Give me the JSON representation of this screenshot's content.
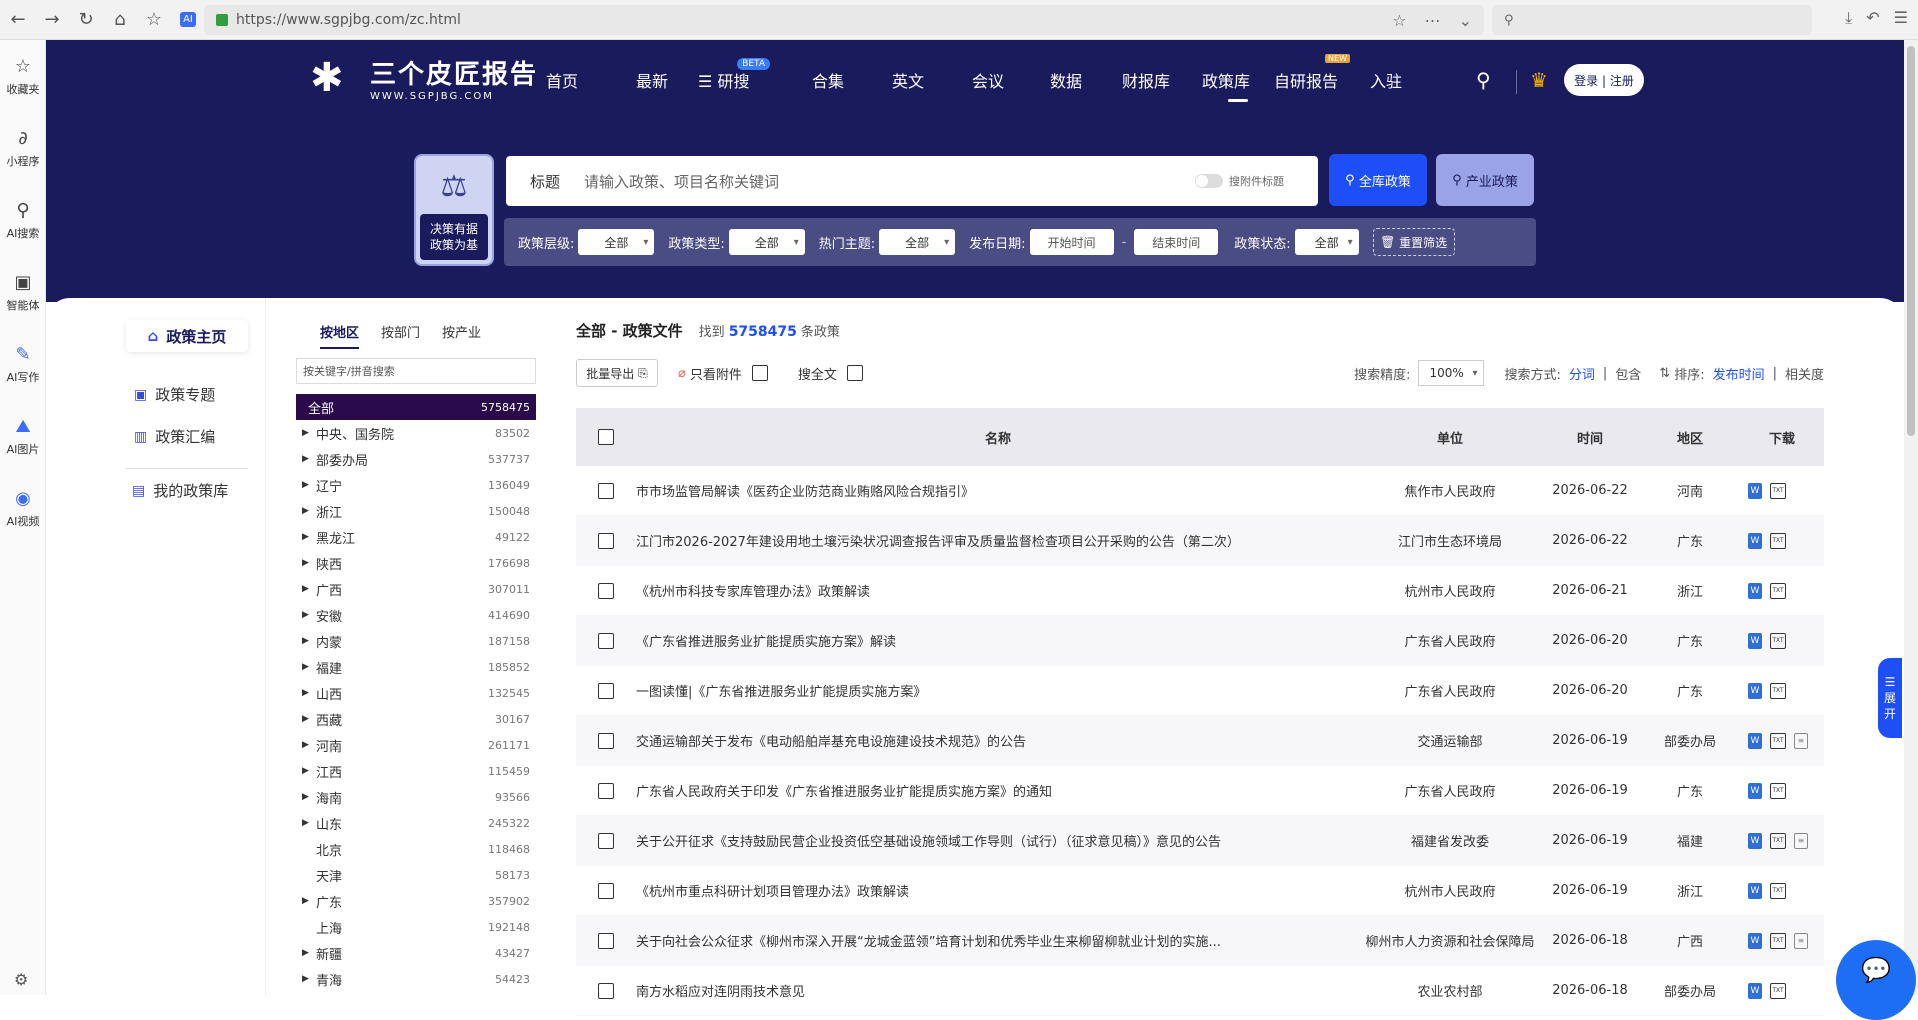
{
  "browser": {
    "url": "https://www.sgpjbg.com/zc.html",
    "sidebar": [
      {
        "label": "收藏夹",
        "icon": "star-icon"
      },
      {
        "label": "小程序",
        "icon": "mini-program-icon"
      },
      {
        "label": "AI搜索",
        "icon": "search-icon"
      },
      {
        "label": "智能体",
        "icon": "agent-icon"
      },
      {
        "label": "AI写作",
        "icon": "pen-icon"
      },
      {
        "label": "AI图片",
        "icon": "image-icon"
      },
      {
        "label": "AI视频",
        "icon": "video-icon"
      }
    ]
  },
  "site": {
    "logo_text": "三个皮匠报告",
    "logo_sub": "WWW.SGPJBG.COM",
    "nav": [
      "首页",
      "最新",
      "研搜",
      "合集",
      "英文",
      "会议",
      "数据",
      "财报库",
      "政策库",
      "自研报告",
      "入驻"
    ],
    "nav_beta": "BETA",
    "nav_new": "NEW",
    "login": "登录 | 注册"
  },
  "search": {
    "slogan1": "决策有据",
    "slogan2": "政策为基",
    "label": "标题",
    "placeholder": "请输入政策、项目名称关键词",
    "toggle_label": "搜附件标题",
    "btn_all": "全库政策",
    "btn_industry": "产业政策",
    "filters": {
      "level_label": "政策层级:",
      "level_value": "全部",
      "type_label": "政策类型:",
      "type_value": "全部",
      "topic_label": "热门主题:",
      "topic_value": "全部",
      "date_label": "发布日期:",
      "start_ph": "开始时间",
      "end_ph": "结束时间",
      "dash": "-",
      "status_label": "政策状态:",
      "status_value": "全部",
      "reset": "重置筛选"
    }
  },
  "leftnav": {
    "main": "政策主页",
    "items": [
      "政策专题",
      "政策汇编"
    ],
    "mine": "我的政策库"
  },
  "regions": {
    "tabs": [
      "按地区",
      "按部门",
      "按产业"
    ],
    "search_ph": "按关键字/拼音搜索",
    "list": [
      {
        "name": "全部",
        "count": "5758475"
      },
      {
        "name": "中央、国务院",
        "count": "83502"
      },
      {
        "name": "部委办局",
        "count": "537737"
      },
      {
        "name": "辽宁",
        "count": "136049"
      },
      {
        "name": "浙江",
        "count": "150048"
      },
      {
        "name": "黑龙江",
        "count": "49122"
      },
      {
        "name": "陕西",
        "count": "176698"
      },
      {
        "name": "广西",
        "count": "307011"
      },
      {
        "name": "安徽",
        "count": "414690"
      },
      {
        "name": "内蒙",
        "count": "187158"
      },
      {
        "name": "福建",
        "count": "185852"
      },
      {
        "name": "山西",
        "count": "132545"
      },
      {
        "name": "西藏",
        "count": "30167"
      },
      {
        "name": "河南",
        "count": "261171"
      },
      {
        "name": "江西",
        "count": "115459"
      },
      {
        "name": "海南",
        "count": "93566"
      },
      {
        "name": "山东",
        "count": "245322"
      },
      {
        "name": "北京",
        "count": "118468"
      },
      {
        "name": "天津",
        "count": "58173"
      },
      {
        "name": "广东",
        "count": "357902"
      },
      {
        "name": "上海",
        "count": "192148"
      },
      {
        "name": "新疆",
        "count": "43427"
      },
      {
        "name": "青海",
        "count": "54423"
      }
    ]
  },
  "main": {
    "title": "全部 - 政策文件",
    "found_pre": "找到",
    "found_count": "5758475",
    "found_post": "条政策",
    "export": "批量导出",
    "only_attach": "只看附件",
    "fulltext": "搜全文",
    "precision_label": "搜索精度:",
    "precision": "100%",
    "mode_label": "搜索方式:",
    "mode_split": "分词",
    "mode_contain": "包含",
    "sort_label": "排序:",
    "sort_date": "发布时间",
    "sort_rel": "相关度",
    "columns": [
      "名称",
      "单位",
      "时间",
      "地区",
      "下载"
    ],
    "rows": [
      {
        "name": "市市场监管局解读《医药企业防范商业贿赂风险合规指引》",
        "unit": "焦作市人民政府",
        "time": "2026-06-22",
        "region": "河南",
        "pdf": false
      },
      {
        "name": "江门市2026-2027年建设用地土壤污染状况调查报告评审及质量监督检查项目公开采购的公告（第二次）",
        "unit": "江门市生态环境局",
        "time": "2026-06-22",
        "region": "广东",
        "pdf": false
      },
      {
        "name": "《杭州市科技专家库管理办法》政策解读",
        "unit": "杭州市人民政府",
        "time": "2026-06-21",
        "region": "浙江",
        "pdf": false
      },
      {
        "name": "《广东省推进服务业扩能提质实施方案》解读",
        "unit": "广东省人民政府",
        "time": "2026-06-20",
        "region": "广东",
        "pdf": false
      },
      {
        "name": "一图读懂|《广东省推进服务业扩能提质实施方案》",
        "unit": "广东省人民政府",
        "time": "2026-06-20",
        "region": "广东",
        "pdf": false
      },
      {
        "name": "交通运输部关于发布《电动船舶岸基充电设施建设技术规范》的公告",
        "unit": "交通运输部",
        "time": "2026-06-19",
        "region": "部委办局",
        "pdf": true
      },
      {
        "name": "广东省人民政府关于印发《广东省推进服务业扩能提质实施方案》的通知",
        "unit": "广东省人民政府",
        "time": "2026-06-19",
        "region": "广东",
        "pdf": false
      },
      {
        "name": "关于公开征求《支持鼓励民营企业投资低空基础设施领域工作导则（试行）（征求意见稿）》意见的公告",
        "unit": "福建省发改委",
        "time": "2026-06-19",
        "region": "福建",
        "pdf": true
      },
      {
        "name": "《杭州市重点科研计划项目管理办法》政策解读",
        "unit": "杭州市人民政府",
        "time": "2026-06-19",
        "region": "浙江",
        "pdf": false
      },
      {
        "name": "关于向社会公众征求《柳州市深入开展“龙城金蓝领”培育计划和优秀毕业生来柳留柳就业计划的实施...",
        "unit": "柳州市人力资源和社会保障局",
        "time": "2026-06-18",
        "region": "广西",
        "pdf": true
      },
      {
        "name": "南方水稻应对连阴雨技术意见",
        "unit": "农业农村部",
        "time": "2026-06-18",
        "region": "部委办局",
        "pdf": false
      }
    ]
  },
  "widgets": {
    "expand": [
      "展",
      "开"
    ]
  }
}
